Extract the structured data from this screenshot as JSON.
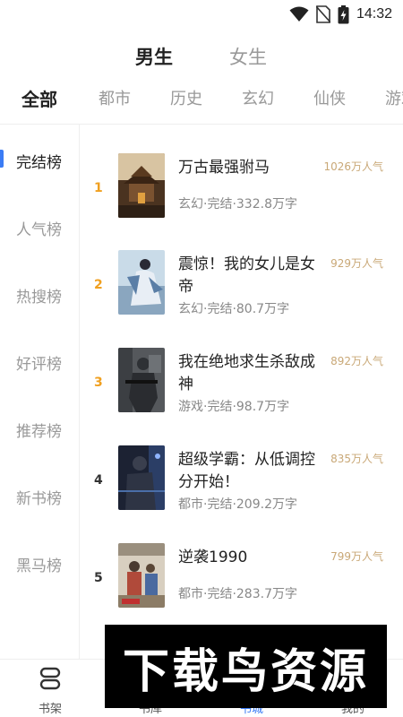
{
  "status_bar": {
    "time": "14:32",
    "icons": [
      "wifi-icon",
      "no-sim-icon",
      "battery-icon"
    ]
  },
  "gender_tabs": [
    {
      "label": "男生",
      "selected": true
    },
    {
      "label": "女生",
      "selected": false
    }
  ],
  "category_tabs": [
    {
      "label": "全部",
      "selected": true
    },
    {
      "label": "都市",
      "selected": false
    },
    {
      "label": "历史",
      "selected": false
    },
    {
      "label": "玄幻",
      "selected": false
    },
    {
      "label": "仙侠",
      "selected": false
    },
    {
      "label": "游戏",
      "selected": false
    }
  ],
  "sidebar": {
    "items": [
      {
        "label": "完结榜",
        "selected": true
      },
      {
        "label": "人气榜",
        "selected": false
      },
      {
        "label": "热搜榜",
        "selected": false
      },
      {
        "label": "好评榜",
        "selected": false
      },
      {
        "label": "推荐榜",
        "selected": false
      },
      {
        "label": "新书榜",
        "selected": false
      },
      {
        "label": "黑马榜",
        "selected": false
      }
    ]
  },
  "books": [
    {
      "rank": "1",
      "title": "万古最强驸马",
      "meta": "玄幻·完结·332.8万字",
      "popularity": "1026万人气"
    },
    {
      "rank": "2",
      "title": "震惊！我的女儿是女帝",
      "meta": "玄幻·完结·80.7万字",
      "popularity": "929万人气"
    },
    {
      "rank": "3",
      "title": "我在绝地求生杀敌成神",
      "meta": "游戏·完结·98.7万字",
      "popularity": "892万人气"
    },
    {
      "rank": "4",
      "title": "超级学霸：从低调控分开始！",
      "meta": "都市·完结·209.2万字",
      "popularity": "835万人气"
    },
    {
      "rank": "5",
      "title": "逆袭1990",
      "meta": "都市·完结·283.7万字",
      "popularity": "799万人气"
    }
  ],
  "bottom_nav": [
    {
      "label": "书架",
      "icon": "bookshelf-icon",
      "selected": false
    },
    {
      "label": "书库",
      "icon": "library-icon",
      "selected": false
    },
    {
      "label": "书城",
      "icon": "bookstore-icon",
      "selected": true
    },
    {
      "label": "我的",
      "icon": "profile-icon",
      "selected": false
    }
  ],
  "watermark": {
    "text": "下载鸟资源"
  },
  "colors": {
    "accent": "#3b7cf5",
    "rank_top": "#f0a020",
    "popularity": "#c9a877",
    "inactive": "#999999"
  }
}
